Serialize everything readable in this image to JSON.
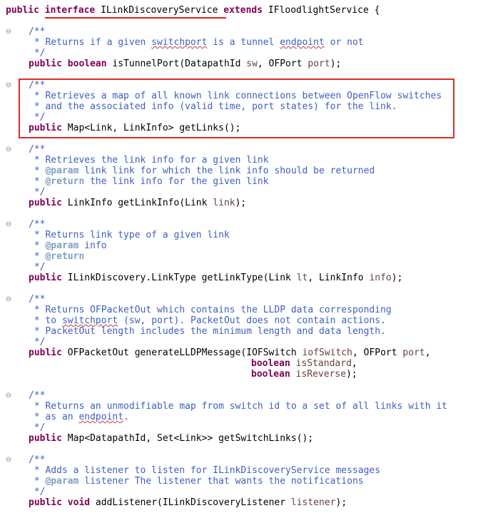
{
  "colors": {
    "keyword": "#7f0055",
    "comment": "#3f5fbf",
    "javadoc_tag": "#7f9fbf",
    "parameter": "#6a3e3e",
    "highlight": "#e02a2a"
  },
  "header": {
    "kw_public": "public",
    "kw_interface": "interface",
    "name": "ILinkDiscoveryService",
    "kw_extends": "extends",
    "parent": "IFloodlightService {"
  },
  "methods": {
    "m1": {
      "c_open": "/**",
      "c1_pre": " * Returns if a given ",
      "c1_w1": "switchport",
      "c1_mid": " is a tunnel ",
      "c1_w2": "endpoint",
      "c1_post": " or not",
      "c_close": " */",
      "kw1": "public",
      "kw2": "boolean",
      "sig_a": " isTunnelPort(DatapathId ",
      "p1": "sw",
      "sig_b": ", OFPort ",
      "p2": "port",
      "sig_c": ");"
    },
    "m2": {
      "c_open": "/**",
      "c1": " * Retrieves a map of all known link connections between OpenFlow switches",
      "c2": " * and the associated info (valid time, port states) for the link.",
      "c_close": " */",
      "kw1": "public",
      "sig": " Map<Link, LinkInfo> getLinks();"
    },
    "m3": {
      "c_open": "/**",
      "c1": " * Retrieves the link info for a given link",
      "c2_pre": " * ",
      "c2_tag": "@param",
      "c2_post": " link link for which the link info should be returned",
      "c3_pre": " * ",
      "c3_tag": "@return",
      "c3_post": " the link info for the given link",
      "c_close": " */",
      "kw1": "public",
      "sig_a": " LinkInfo getLinkInfo(Link ",
      "p1": "link",
      "sig_b": ");"
    },
    "m4": {
      "c_open": "/**",
      "c1": " * Returns link type of a given link",
      "c2_pre": " * ",
      "c2_tag": "@param",
      "c2_post": " info",
      "c3_pre": " * ",
      "c3_tag": "@return",
      "c_close": " */",
      "kw1": "public",
      "sig_a": " ILinkDiscovery.LinkType getLinkType(Link ",
      "p1": "lt",
      "sig_b": ", LinkInfo ",
      "p2": "info",
      "sig_c": ");"
    },
    "m5": {
      "c_open": "/**",
      "c1": " * Returns OFPacketOut which contains the LLDP data corresponding",
      "c2_pre": " * to ",
      "c2_w1": "switchport",
      "c2_post": " (sw, port). PacketOut does not contain actions.",
      "c3": " * PacketOut length includes the minimum length and data length.",
      "c_close": " */",
      "kw1": "public",
      "sig_a": " OFPacketOut generateLLDPMessage(IOFSwitch ",
      "p1": "iofSwitch",
      "sig_b": ", OFPort ",
      "p2": "port",
      "sig_c": ",",
      "kw_bool1": "boolean",
      "p3": "isStandard",
      "sig_d": ",",
      "kw_bool2": "boolean",
      "p4": "isReverse",
      "sig_e": ");"
    },
    "m6": {
      "c_open": "/**",
      "c1": " * Returns an unmodifiable map from switch id to a set of all links with it",
      "c2_pre": " * as an ",
      "c2_w1": "endpoint",
      "c2_post": ".",
      "c_close": " */",
      "kw1": "public",
      "sig": " Map<DatapathId, Set<Link>> getSwitchLinks();"
    },
    "m7": {
      "c_open": "/**",
      "c1": " * Adds a listener to listen for ILinkDiscoveryService messages",
      "c2_pre": " * ",
      "c2_tag": "@param",
      "c2_post": " listener The listener that wants the notifications",
      "c_close": " */",
      "kw1": "public",
      "kw2": "void",
      "sig_a": " addListener(ILinkDiscoveryListener ",
      "p1": "listener",
      "sig_b": ");"
    }
  },
  "gutter_icons": [
    "fold-minus",
    "fold-minus",
    "fold-minus",
    "fold-minus",
    "fold-minus",
    "fold-minus",
    "fold-minus"
  ]
}
